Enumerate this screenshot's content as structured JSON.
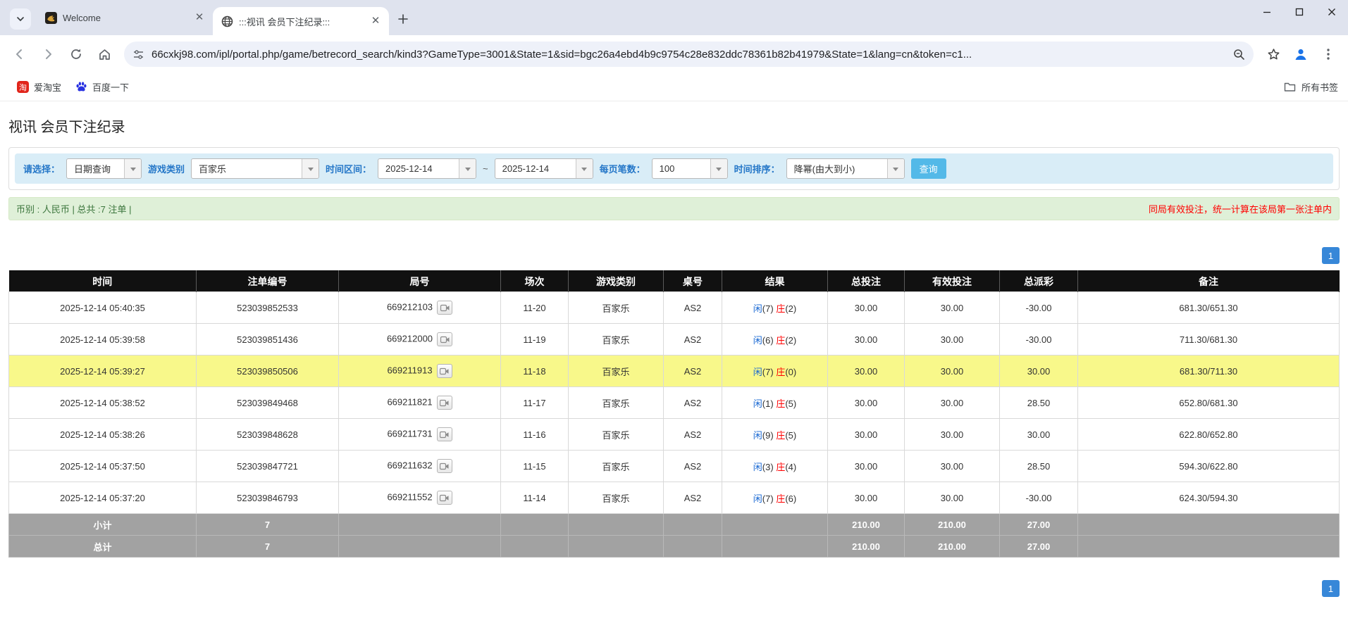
{
  "browser": {
    "tabs": [
      {
        "title": "Welcome"
      },
      {
        "title": ":::视讯 会员下注纪录:::"
      }
    ],
    "url": "66cxkj98.com/ipl/portal.php/game/betrecord_search/kind3?GameType=3001&State=1&sid=bgc26a4ebd4b9c9754c28e832ddc78361b82b41979&State=1&lang=cn&token=c1...",
    "bookmarks": [
      {
        "label": "爱淘宝"
      },
      {
        "label": "百度一下"
      }
    ],
    "all_bookmarks_label": "所有书签",
    "taobao_glyph": "淘"
  },
  "page": {
    "title": "视讯 会员下注纪录",
    "filters": {
      "select_label": "请选择：",
      "select_value": "日期查询",
      "game_type_label": "游戏类别",
      "game_type_value": "百家乐",
      "date_range_label": "时间区间：",
      "date_from": "2025-12-14",
      "tilde": "~",
      "date_to": "2025-12-14",
      "page_size_label": "每页笔数：",
      "page_size_value": "100",
      "sort_label": "时间排序：",
      "sort_value": "降幂(由大到小)",
      "search_button": "查询"
    },
    "summary_bar": {
      "left": "币别 : 人民币 | 总共 :7 注单 |",
      "right": "同局有效投注，统一计算在该局第一张注单内"
    },
    "pagination": "1",
    "table": {
      "headers": [
        "时间",
        "注单编号",
        "局号",
        "场次",
        "游戏类别",
        "桌号",
        "结果",
        "总投注",
        "有效投注",
        "总派彩",
        "备注"
      ],
      "rows": [
        {
          "time": "2025-12-14 05:40:35",
          "bet_id": "523039852533",
          "round": "669212103",
          "session": "11-20",
          "game": "百家乐",
          "table_no": "AS2",
          "result": "闲(7) 庄(2)",
          "total_bet": "30.00",
          "valid_bet": "30.00",
          "total_payout": "-30.00",
          "remark": "681.30/651.30",
          "highlight": false
        },
        {
          "time": "2025-12-14 05:39:58",
          "bet_id": "523039851436",
          "round": "669212000",
          "session": "11-19",
          "game": "百家乐",
          "table_no": "AS2",
          "result": "闲(6) 庄(2)",
          "total_bet": "30.00",
          "valid_bet": "30.00",
          "total_payout": "-30.00",
          "remark": "711.30/681.30",
          "highlight": false
        },
        {
          "time": "2025-12-14 05:39:27",
          "bet_id": "523039850506",
          "round": "669211913",
          "session": "11-18",
          "game": "百家乐",
          "table_no": "AS2",
          "result": "闲(7) 庄(0)",
          "total_bet": "30.00",
          "valid_bet": "30.00",
          "total_payout": "30.00",
          "remark": "681.30/711.30",
          "highlight": true
        },
        {
          "time": "2025-12-14 05:38:52",
          "bet_id": "523039849468",
          "round": "669211821",
          "session": "11-17",
          "game": "百家乐",
          "table_no": "AS2",
          "result": "闲(1) 庄(5)",
          "total_bet": "30.00",
          "valid_bet": "30.00",
          "total_payout": "28.50",
          "remark": "652.80/681.30",
          "highlight": false
        },
        {
          "time": "2025-12-14 05:38:26",
          "bet_id": "523039848628",
          "round": "669211731",
          "session": "11-16",
          "game": "百家乐",
          "table_no": "AS2",
          "result": "闲(9) 庄(5)",
          "total_bet": "30.00",
          "valid_bet": "30.00",
          "total_payout": "30.00",
          "remark": "622.80/652.80",
          "highlight": false
        },
        {
          "time": "2025-12-14 05:37:50",
          "bet_id": "523039847721",
          "round": "669211632",
          "session": "11-15",
          "game": "百家乐",
          "table_no": "AS2",
          "result": "闲(3) 庄(4)",
          "total_bet": "30.00",
          "valid_bet": "30.00",
          "total_payout": "28.50",
          "remark": "594.30/622.80",
          "highlight": false
        },
        {
          "time": "2025-12-14 05:37:20",
          "bet_id": "523039846793",
          "round": "669211552",
          "session": "11-14",
          "game": "百家乐",
          "table_no": "AS2",
          "result": "闲(7) 庄(6)",
          "total_bet": "30.00",
          "valid_bet": "30.00",
          "total_payout": "-30.00",
          "remark": "624.30/594.30",
          "highlight": false
        }
      ],
      "subtotal": {
        "label": "小计",
        "count": "7",
        "total_bet": "210.00",
        "valid_bet": "210.00",
        "total_payout": "27.00"
      },
      "total": {
        "label": "总计",
        "count": "7",
        "total_bet": "210.00",
        "valid_bet": "210.00",
        "total_payout": "27.00"
      }
    },
    "colors": {
      "link_blue": "#1767d2",
      "negative_red": "#ff0000",
      "highlight_yellow": "#f8f88a",
      "header_black": "#111111",
      "search_button_blue": "#53b9e8",
      "summary_green_bg": "#dff0d8",
      "filter_bar_bg": "#d9edf7",
      "pager_blue": "#3787d8"
    }
  }
}
